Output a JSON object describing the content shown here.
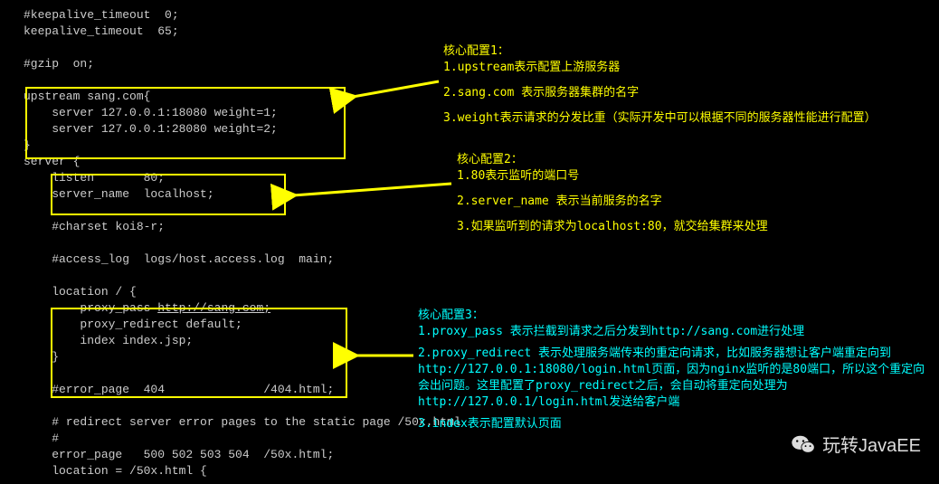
{
  "code": {
    "l1": "#keepalive_timeout  0;",
    "l2": "keepalive_timeout  65;",
    "l3": "",
    "l4": "#gzip  on;",
    "l5": "",
    "l6": "upstream sang.com{",
    "l7": "    server 127.0.0.1:18080 weight=1;",
    "l8": "    server 127.0.0.1:28080 weight=2;",
    "l9": "}",
    "l10": "server {",
    "l11": "    listen       80;",
    "l12": "    server_name  localhost;",
    "l13": "",
    "l14": "    #charset koi8-r;",
    "l15": "",
    "l16": "    #access_log  logs/host.access.log  main;",
    "l17": "",
    "l18": "    location / {",
    "l19_a": "        proxy_pass ",
    "l19_b": "http://sang.com;",
    "l20": "        proxy_redirect default;",
    "l21": "        index index.jsp;",
    "l22": "    }",
    "l23": "",
    "l24": "    #error_page  404              /404.html;",
    "l25": "",
    "l26": "    # redirect server error pages to the static page /50x.html",
    "l27": "    #",
    "l28": "    error_page   500 502 503 504  /50x.html;",
    "l29": "    location = /50x.html {"
  },
  "anno1": {
    "title": "核心配置1：",
    "p1": "1.upstream表示配置上游服务器",
    "p2": "2.sang.com 表示服务器集群的名字",
    "p3": "3.weight表示请求的分发比重（实际开发中可以根据不同的服务器性能进行配置）"
  },
  "anno2": {
    "title": "核心配置2：",
    "p1": "1.80表示监听的端口号",
    "p2": "2.server_name 表示当前服务的名字",
    "p3": "3.如果监听到的请求为localhost:80，就交给集群来处理"
  },
  "anno3": {
    "title": "核心配置3：",
    "p1": "1.proxy_pass 表示拦截到请求之后分发到http://sang.com进行处理",
    "p2": "2.proxy_redirect 表示处理服务端传来的重定向请求，比如服务器想让客户端重定向到http://127.0.0.1:18080/login.html页面，因为nginx监听的是80端口，所以这个重定向会出问题。这里配置了proxy_redirect之后，会自动将重定向处理为http://127.0.0.1/login.html发送给客户端",
    "p3": "3.index表示配置默认页面"
  },
  "watermark": "玩转JavaEE"
}
